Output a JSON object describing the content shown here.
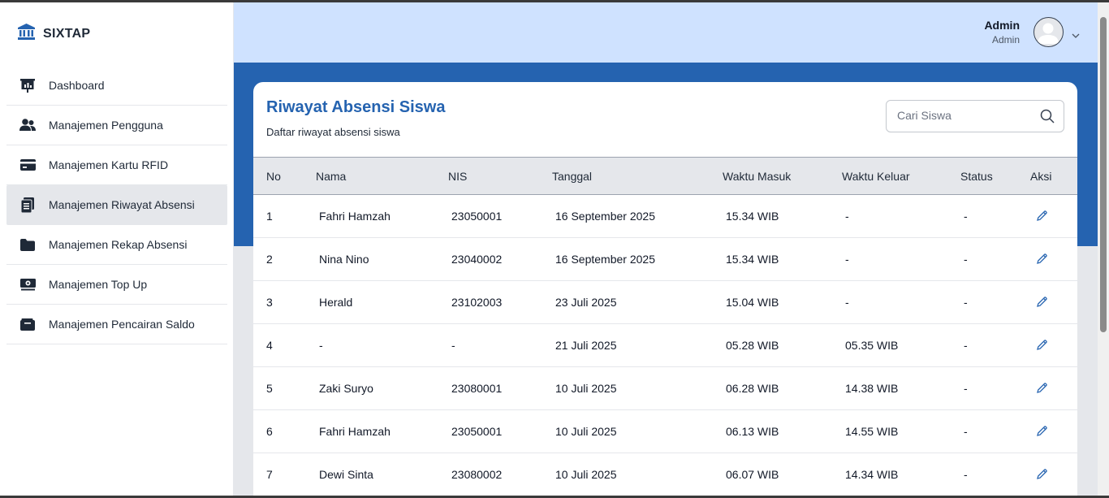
{
  "brand": {
    "name": "SIXTAP",
    "icon": "bank-icon"
  },
  "sidebar": {
    "items": [
      {
        "label": "Dashboard",
        "icon": "chart-board-icon",
        "active": false
      },
      {
        "label": "Manajemen Pengguna",
        "icon": "users-icon",
        "active": false
      },
      {
        "label": "Manajemen Kartu RFID",
        "icon": "credit-card-icon",
        "active": false
      },
      {
        "label": "Manajemen Riwayat Absensi",
        "icon": "clipboard-list-icon",
        "active": true
      },
      {
        "label": "Manajemen Rekap Absensi",
        "icon": "folder-icon",
        "active": false
      },
      {
        "label": "Manajemen Top Up",
        "icon": "money-bill-icon",
        "active": false
      },
      {
        "label": "Manajemen Pencairan Saldo",
        "icon": "wallet-icon",
        "active": false
      }
    ]
  },
  "header": {
    "user_name": "Admin",
    "user_role": "Admin"
  },
  "page": {
    "title": "Riwayat Absensi Siswa",
    "subtitle": "Daftar riwayat absensi siswa",
    "search_placeholder": "Cari Siswa"
  },
  "table": {
    "headers": {
      "no": "No",
      "nama": "Nama",
      "nis": "NIS",
      "tanggal": "Tanggal",
      "masuk": "Waktu Masuk",
      "keluar": "Waktu Keluar",
      "status": "Status",
      "aksi": "Aksi"
    },
    "rows": [
      {
        "no": "1",
        "nama": "Fahri Hamzah",
        "nis": "23050001",
        "tanggal": "16 September 2025",
        "masuk": "15.34 WIB",
        "keluar": "-",
        "status": "-"
      },
      {
        "no": "2",
        "nama": "Nina Nino",
        "nis": "23040002",
        "tanggal": "16 September 2025",
        "masuk": "15.34 WIB",
        "keluar": "-",
        "status": "-"
      },
      {
        "no": "3",
        "nama": "Herald",
        "nis": "23102003",
        "tanggal": "23 Juli 2025",
        "masuk": "15.04 WIB",
        "keluar": "-",
        "status": "-"
      },
      {
        "no": "4",
        "nama": "-",
        "nis": "-",
        "tanggal": "21 Juli 2025",
        "masuk": "05.28 WIB",
        "keluar": "05.35 WIB",
        "status": "-"
      },
      {
        "no": "5",
        "nama": "Zaki Suryo",
        "nis": "23080001",
        "tanggal": "10 Juli 2025",
        "masuk": "06.28 WIB",
        "keluar": "14.38 WIB",
        "status": "-"
      },
      {
        "no": "6",
        "nama": "Fahri Hamzah",
        "nis": "23050001",
        "tanggal": "10 Juli 2025",
        "masuk": "06.13 WIB",
        "keluar": "14.55 WIB",
        "status": "-"
      },
      {
        "no": "7",
        "nama": "Dewi Sinta",
        "nis": "23080002",
        "tanggal": "10 Juli 2025",
        "masuk": "06.07 WIB",
        "keluar": "14.34 WIB",
        "status": "-"
      }
    ]
  },
  "colors": {
    "primary": "#2563b0",
    "header_bg": "#cfe2ff",
    "active_bg": "#e5e7eb"
  }
}
